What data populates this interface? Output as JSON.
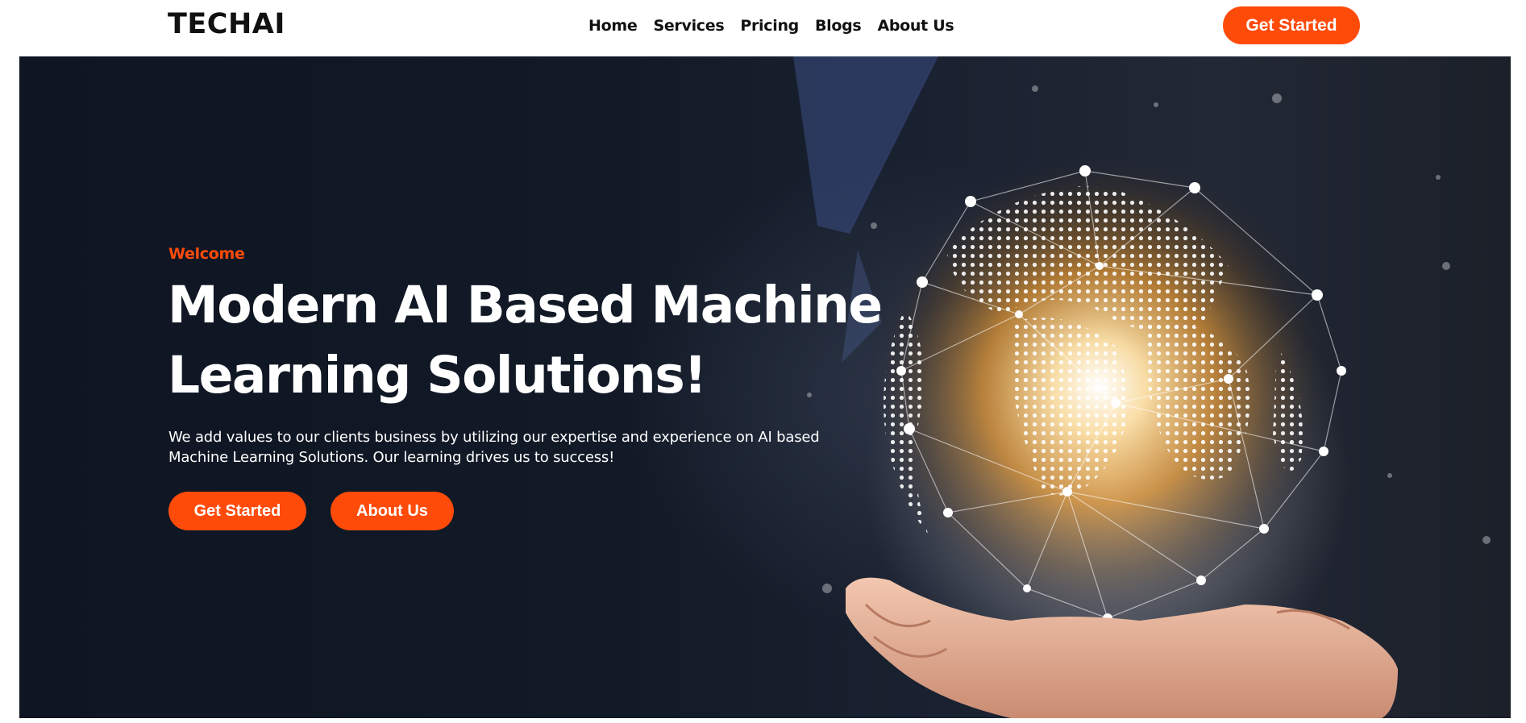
{
  "header": {
    "brand": "TECHAI",
    "nav": [
      "Home",
      "Services",
      "Pricing",
      "Blogs",
      "About Us"
    ],
    "cta_label": "Get Started"
  },
  "hero": {
    "eyebrow": "Welcome",
    "title": "Modern AI Based Machine Learning Solutions!",
    "description": "We add values to our clients business by utilizing our expertise and experience on AI based Machine Learning Solutions. Our learning drives us to success!",
    "primary_button": "Get Started",
    "secondary_button": "About Us",
    "image": "hand-holding-glowing-globe-image"
  },
  "colors": {
    "accent": "#ff4b0a",
    "hero_background": "#121a27",
    "text_dark": "#111111",
    "text_light": "#ffffff"
  }
}
